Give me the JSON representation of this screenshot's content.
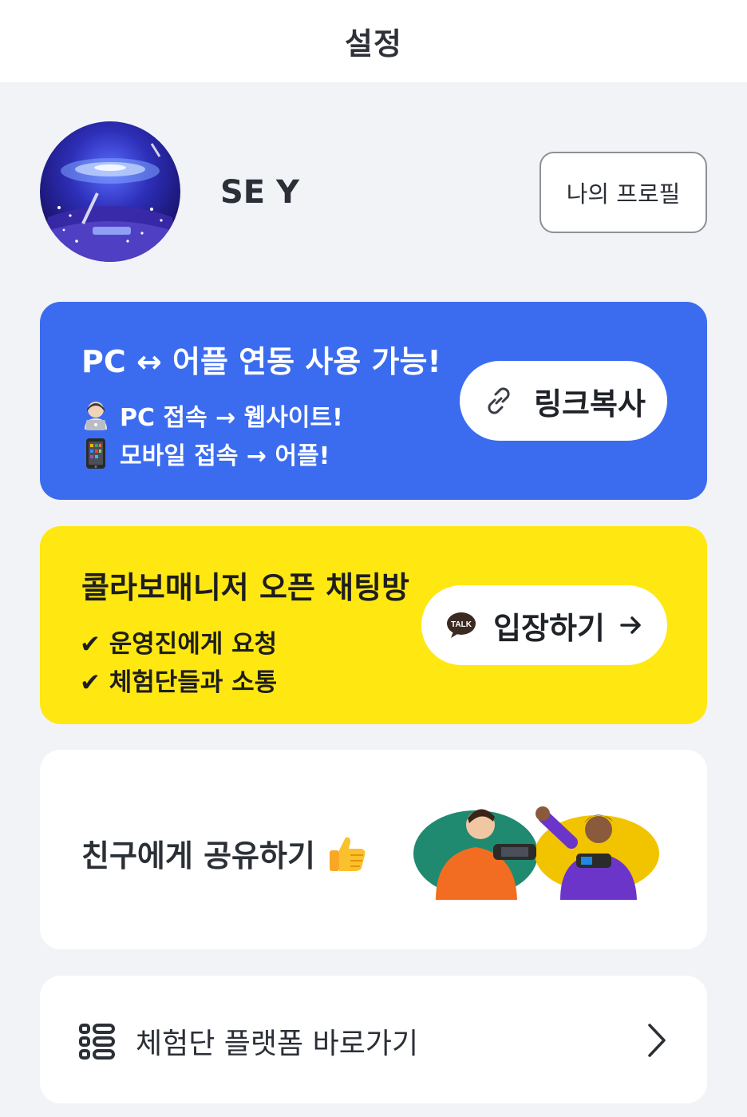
{
  "header": {
    "title": "설정"
  },
  "profile": {
    "username": "SE Y",
    "my_profile_button": "나의 프로필"
  },
  "pc_app_card": {
    "title": "PC ↔ 어플 연동 사용 가능!",
    "line1": "PC 접속 → 웹사이트!",
    "line1_icon": "person-laptop-emoji",
    "line2": "모바일 접속 → 어플!",
    "line2_icon": "mobile-phone-emoji",
    "button_label": "링크복사",
    "button_icon": "link-icon",
    "background": "#3b6cf0"
  },
  "open_chat_card": {
    "title": "콜라보매니저 오픈 채팅방",
    "line1": "✔ 운영진에게 요청",
    "line2": "✔ 체험단들과 소통",
    "button_label": "입장하기",
    "button_icon": "talk-bubble-icon",
    "button_badge": "TALK",
    "arrow": "→",
    "background": "#ffe712"
  },
  "share_card": {
    "title": "친구에게 공유하기",
    "icon": "thumbs-up-emoji"
  },
  "nav_card": {
    "label": "체험단 플랫폼 바로가기",
    "icon": "grid-menu-icon",
    "chevron": "chevron-right-icon"
  }
}
